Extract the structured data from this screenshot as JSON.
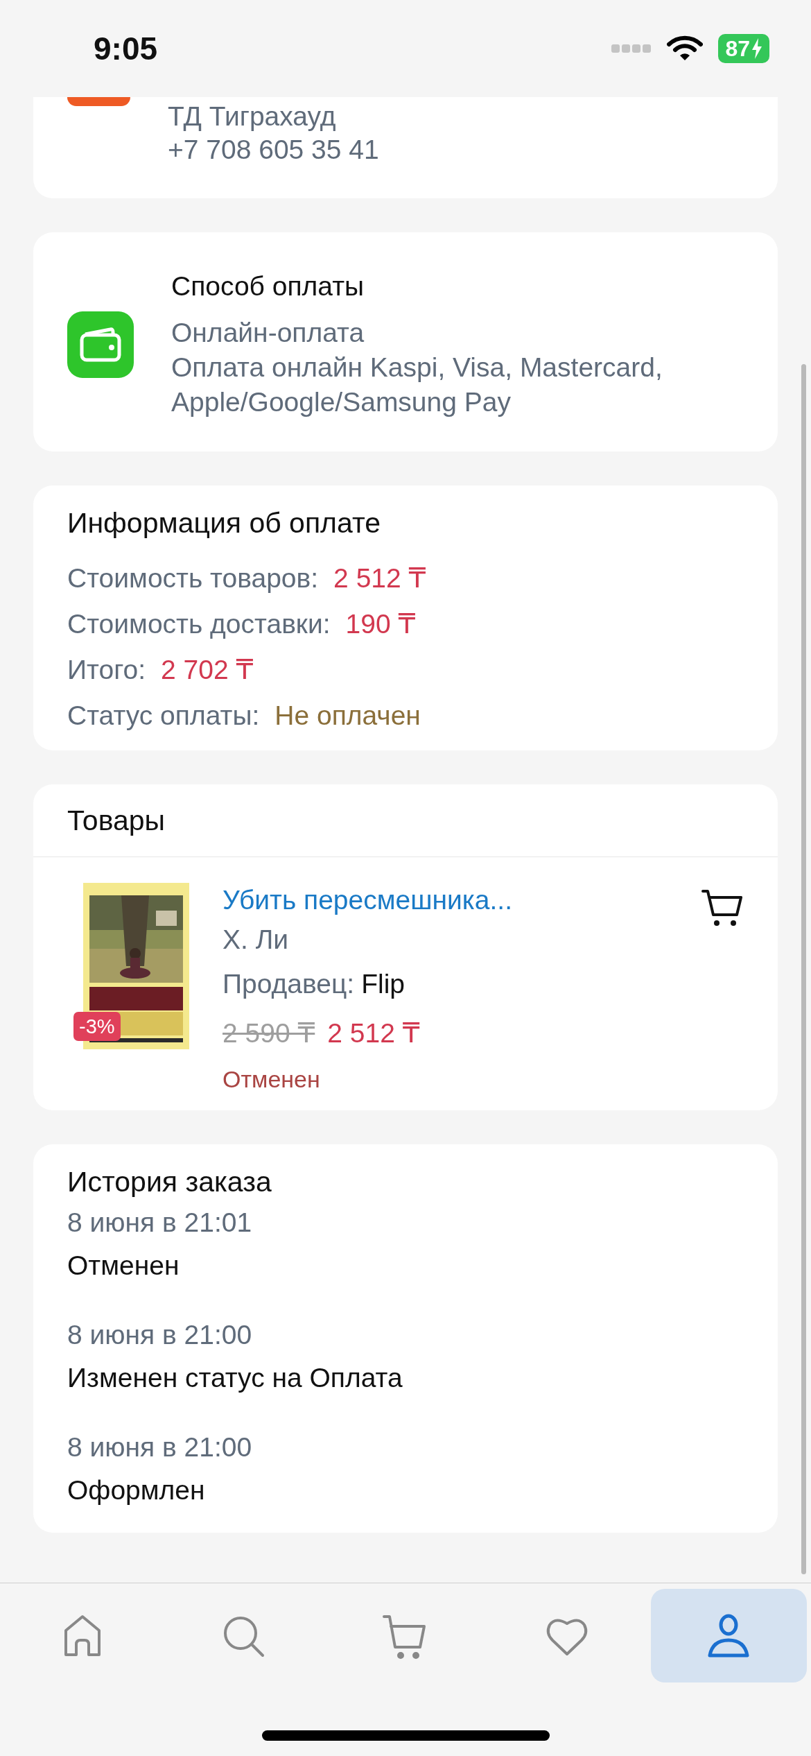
{
  "status_bar": {
    "time": "9:05",
    "battery": "87"
  },
  "store_card": {
    "name": "ТД Тиграхауд",
    "phone": "+7 708 605 35 41"
  },
  "payment_method": {
    "title": "Способ оплаты",
    "method": "Онлайн-оплата",
    "details": "Оплата онлайн Kaspi, Visa, Mastercard, Apple/Google/Samsung Pay"
  },
  "payment_info": {
    "title": "Информация об оплате",
    "rows": [
      {
        "label": "Стоимость товаров:",
        "value": "2 512 ₸",
        "kind": "price"
      },
      {
        "label": "Стоимость доставки:",
        "value": "190 ₸",
        "kind": "price"
      },
      {
        "label": "Итого:",
        "value": "2 702 ₸",
        "kind": "price"
      },
      {
        "label": "Статус оплаты:",
        "value": "Не оплачен",
        "kind": "status"
      }
    ]
  },
  "products": {
    "title": "Товары",
    "items": [
      {
        "kind": "picture",
        "title": "Убить пересмешника...",
        "author": "Х. Ли",
        "seller_label": "Продавец:",
        "seller": "Flip",
        "old_price": "2 590 ₸",
        "price": "2 512 ₸",
        "discount": "-3%",
        "status": "Отменен"
      }
    ]
  },
  "order_history": {
    "title": "История заказа",
    "entries": [
      {
        "date": "8 июня в 21:01",
        "text": "Отменен"
      },
      {
        "date": "8 июня в 21:00",
        "text": "Изменен статус на Оплата"
      },
      {
        "date": "8 июня в 21:00",
        "text": "Оформлен"
      }
    ]
  },
  "bottom_nav": {
    "tabs": [
      {
        "kind": "home",
        "selected": false
      },
      {
        "kind": "search",
        "selected": false
      },
      {
        "kind": "cart",
        "selected": false
      },
      {
        "kind": "heart",
        "selected": false
      },
      {
        "kind": "profile",
        "selected": true
      }
    ]
  }
}
